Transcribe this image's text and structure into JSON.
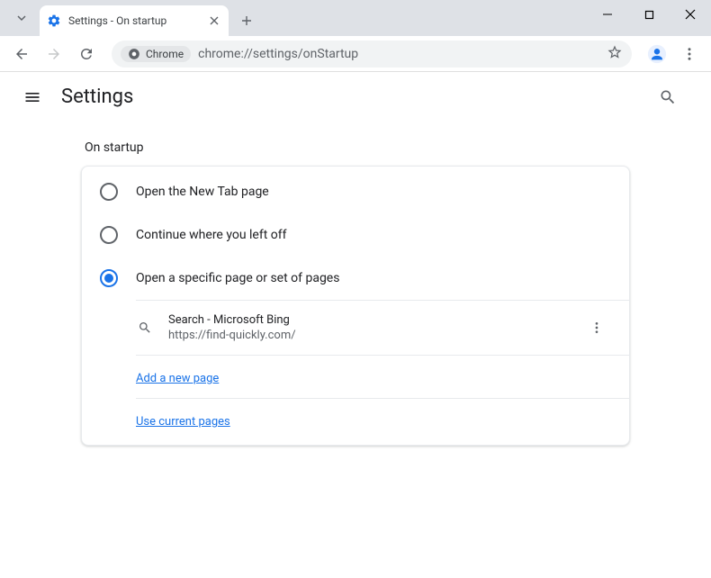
{
  "window": {
    "tab_title": "Settings - On startup"
  },
  "toolbar": {
    "chrome_label": "Chrome",
    "url": "chrome://settings/onStartup"
  },
  "header": {
    "title": "Settings"
  },
  "section": {
    "heading": "On startup",
    "options": {
      "new_tab": "Open the New Tab page",
      "continue": "Continue where you left off",
      "specific": "Open a specific page or set of pages"
    },
    "pages": [
      {
        "title": "Search - Microsoft Bing",
        "url": "https://find-quickly.com/"
      }
    ],
    "add_page": "Add a new page",
    "use_current": "Use current pages"
  }
}
